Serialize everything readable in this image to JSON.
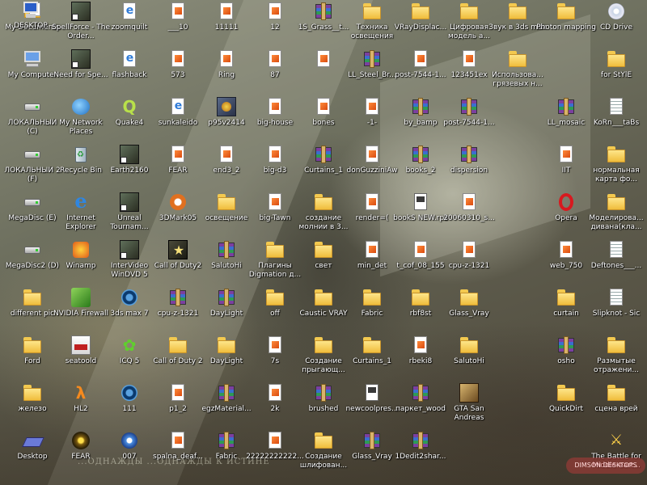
{
  "desktop": {
    "icons": [
      {
        "label": "My Documents",
        "type": "mydocs",
        "icon": "my-documents-icon"
      },
      {
        "label": "SpellForce - The Order...",
        "type": "shortcut",
        "icon": "spellforce-icon"
      },
      {
        "label": "zoomquilt",
        "type": "web",
        "icon": "html-file-icon"
      },
      {
        "label": "___10",
        "type": "file",
        "icon": "image-file-icon"
      },
      {
        "label": "11111",
        "type": "file",
        "icon": "image-file-icon"
      },
      {
        "label": "12",
        "type": "file",
        "icon": "image-file-icon"
      },
      {
        "label": "1S_Grass__t...",
        "type": "rar",
        "icon": "archive-icon"
      },
      {
        "label": "Техника освещения",
        "type": "folder",
        "icon": "folder-icon"
      },
      {
        "label": "VRayDisplac...",
        "type": "folder",
        "icon": "folder-icon"
      },
      {
        "label": "Цифровая модель а...",
        "type": "folder",
        "icon": "folder-icon"
      },
      {
        "label": "Звук в 3ds max",
        "type": "folder",
        "icon": "folder-icon"
      },
      {
        "label": "Photon mapping",
        "type": "folder",
        "icon": "folder-icon"
      },
      {
        "label": "CD Drive",
        "type": "cd",
        "icon": "cd-drive-icon"
      },
      {
        "label": "My Computer",
        "type": "mycomp",
        "icon": "my-computer-icon"
      },
      {
        "label": "Need for Spe...",
        "type": "shortcut",
        "icon": "need-for-speed-icon"
      },
      {
        "label": "flashback",
        "type": "web",
        "icon": "html-file-icon"
      },
      {
        "label": "573",
        "type": "file",
        "icon": "image-file-icon"
      },
      {
        "label": "Ring",
        "type": "file",
        "icon": "image-file-icon"
      },
      {
        "label": "87",
        "type": "file",
        "icon": "image-file-icon"
      },
      {
        "label": "",
        "type": "file",
        "icon": "image-file-icon"
      },
      {
        "label": "LL_Steel_Br...",
        "type": "rar",
        "icon": "archive-icon"
      },
      {
        "label": "post-7544-1...",
        "type": "file",
        "icon": "image-file-icon"
      },
      {
        "label": "123451ex",
        "type": "file",
        "icon": "image-file-icon"
      },
      {
        "label": "Использова... грязевых н...",
        "type": "folder",
        "icon": "folder-icon"
      },
      {
        "label": "for StYlE",
        "type": "folder",
        "icon": "folder-icon"
      },
      {
        "label": "ЛОКАЛЬНЫЙ (C)",
        "type": "drive",
        "icon": "hard-drive-icon"
      },
      {
        "label": "My Network Places",
        "type": "network",
        "icon": "network-places-icon"
      },
      {
        "label": "Quake4",
        "type": "quake",
        "icon": "quake4-icon"
      },
      {
        "label": "sunkaleido",
        "type": "web",
        "icon": "html-file-icon"
      },
      {
        "label": "p95v2414",
        "type": "app",
        "icon": "program-icon"
      },
      {
        "label": "big-house",
        "type": "file",
        "icon": "image-file-icon"
      },
      {
        "label": "bones",
        "type": "file",
        "icon": "image-file-icon"
      },
      {
        "label": "-1-",
        "type": "file",
        "icon": "image-file-icon"
      },
      {
        "label": "by_bamp",
        "type": "rar",
        "icon": "archive-icon"
      },
      {
        "label": "post-7544-1...",
        "type": "rar",
        "icon": "archive-icon"
      },
      {
        "label": "LL_mosaic",
        "type": "rar",
        "icon": "archive-icon"
      },
      {
        "label": "KoRn___taBs",
        "type": "txt",
        "icon": "text-file-icon"
      },
      {
        "label": "ЛОКАЛЬНЫЙ 2 (F)",
        "type": "drive",
        "icon": "hard-drive-icon"
      },
      {
        "label": "Recycle Bin",
        "type": "recycle",
        "icon": "recycle-bin-icon"
      },
      {
        "label": "Earth2160",
        "type": "shortcut",
        "icon": "earth2160-icon"
      },
      {
        "label": "FEAR",
        "type": "file",
        "icon": "image-file-icon"
      },
      {
        "label": "end3_2",
        "type": "file",
        "icon": "image-file-icon"
      },
      {
        "label": "big-d3",
        "type": "file",
        "icon": "image-file-icon"
      },
      {
        "label": "Curtains_1",
        "type": "rar",
        "icon": "archive-icon"
      },
      {
        "label": "donGuzziniAw",
        "type": "file",
        "icon": "image-file-icon"
      },
      {
        "label": "books_2",
        "type": "rar",
        "icon": "archive-icon"
      },
      {
        "label": "dispersion",
        "type": "rar",
        "icon": "archive-icon"
      },
      {
        "label": "IIT",
        "type": "file",
        "icon": "image-file-icon"
      },
      {
        "label": "нормальная карта фо...",
        "type": "folder",
        "icon": "folder-icon"
      },
      {
        "label": "MegaDisc (E)",
        "type": "drive",
        "icon": "hard-drive-icon"
      },
      {
        "label": "Internet Explorer",
        "type": "ie",
        "icon": "internet-explorer-icon"
      },
      {
        "label": "Unreal Tournam...",
        "type": "shortcut",
        "icon": "unreal-tournament-icon"
      },
      {
        "label": "3DMark05",
        "type": "mark3d",
        "icon": "3dmark-icon"
      },
      {
        "label": "освещение",
        "type": "folder",
        "icon": "folder-icon"
      },
      {
        "label": "big-Tawn",
        "type": "file",
        "icon": "image-file-icon"
      },
      {
        "label": "создание молнии в 3...",
        "type": "folder",
        "icon": "folder-icon"
      },
      {
        "label": "render=(",
        "type": "file",
        "icon": "image-file-icon"
      },
      {
        "label": "bookS NEW.rps",
        "type": "rps",
        "icon": "rps-file-icon"
      },
      {
        "label": "20060310_s...",
        "type": "file",
        "icon": "image-file-icon"
      },
      {
        "label": "Opera",
        "type": "opera",
        "icon": "opera-icon"
      },
      {
        "label": "Моделирова... дивана(кла...",
        "type": "folder",
        "icon": "folder-icon"
      },
      {
        "label": "MegaDisc2 (D)",
        "type": "drive",
        "icon": "hard-drive-icon"
      },
      {
        "label": "Winamp",
        "type": "winamp",
        "icon": "winamp-icon"
      },
      {
        "label": "InterVideo WinDVD 5",
        "type": "shortcut",
        "icon": "windvd-icon"
      },
      {
        "label": "Call of Duty2",
        "type": "cod",
        "icon": "call-of-duty-icon"
      },
      {
        "label": "SalutoHi",
        "type": "rar",
        "icon": "archive-icon"
      },
      {
        "label": "Плагины Digmation д...",
        "type": "folder",
        "icon": "folder-icon"
      },
      {
        "label": "свет",
        "type": "folder",
        "icon": "folder-icon"
      },
      {
        "label": "min_det",
        "type": "file",
        "icon": "image-file-icon"
      },
      {
        "label": "t_cof_08_155",
        "type": "file",
        "icon": "image-file-icon"
      },
      {
        "label": "cpu-z-1321",
        "type": "file",
        "icon": "image-file-icon"
      },
      {
        "label": "web_750",
        "type": "file",
        "icon": "image-file-icon"
      },
      {
        "label": "Deftones___...",
        "type": "txt",
        "icon": "text-file-icon"
      },
      {
        "label": "different pic",
        "type": "folder",
        "icon": "folder-icon"
      },
      {
        "label": "NVIDIA Firewall",
        "type": "nvidia",
        "icon": "nvidia-firewall-icon"
      },
      {
        "label": "3ds max 7",
        "type": "max",
        "icon": "3ds-max-icon"
      },
      {
        "label": "cpu-z-1321",
        "type": "rar",
        "icon": "archive-icon"
      },
      {
        "label": "DayLight",
        "type": "rar",
        "icon": "archive-icon"
      },
      {
        "label": "off",
        "type": "folder",
        "icon": "folder-icon"
      },
      {
        "label": "Caustic VRAY",
        "type": "folder",
        "icon": "folder-icon"
      },
      {
        "label": "Fabric",
        "type": "folder",
        "icon": "folder-icon"
      },
      {
        "label": "rbf8st",
        "type": "folder",
        "icon": "folder-icon"
      },
      {
        "label": "Glass_Vray",
        "type": "folder",
        "icon": "folder-icon"
      },
      {
        "label": "curtain",
        "type": "folder",
        "icon": "folder-icon"
      },
      {
        "label": "Slipknot - Sic",
        "type": "txt",
        "icon": "text-file-icon"
      },
      {
        "label": "Ford",
        "type": "folder",
        "icon": "folder-icon"
      },
      {
        "label": "seatoold",
        "type": "cassette",
        "icon": "cassette-icon"
      },
      {
        "label": "ICQ 5",
        "type": "icq",
        "icon": "icq-icon"
      },
      {
        "label": "Call of Duty 2",
        "type": "folder",
        "icon": "folder-icon"
      },
      {
        "label": "DayLight",
        "type": "folder",
        "icon": "folder-icon"
      },
      {
        "label": "7s",
        "type": "file",
        "icon": "image-file-icon"
      },
      {
        "label": "Создание прыгающ...",
        "type": "folder",
        "icon": "folder-icon"
      },
      {
        "label": "Curtains_1",
        "type": "folder",
        "icon": "folder-icon"
      },
      {
        "label": "rbeki8",
        "type": "file",
        "icon": "image-file-icon"
      },
      {
        "label": "SalutoHi",
        "type": "folder",
        "icon": "folder-icon"
      },
      {
        "label": "osho",
        "type": "rar",
        "icon": "archive-icon"
      },
      {
        "label": "Размытые отражени...",
        "type": "folder",
        "icon": "folder-icon"
      },
      {
        "label": "железо",
        "type": "folder",
        "icon": "folder-icon"
      },
      {
        "label": "HL2",
        "type": "hl2",
        "icon": "half-life-2-icon"
      },
      {
        "label": "111",
        "type": "max",
        "icon": "3ds-max-file-icon"
      },
      {
        "label": "p1_2",
        "type": "file",
        "icon": "image-file-icon"
      },
      {
        "label": "egzMaterial...",
        "type": "rar",
        "icon": "archive-icon"
      },
      {
        "label": "2k",
        "type": "file",
        "icon": "image-file-icon"
      },
      {
        "label": "brushed",
        "type": "rar",
        "icon": "archive-icon"
      },
      {
        "label": "newcoolpres...",
        "type": "rps",
        "icon": "rps-file-icon"
      },
      {
        "label": "паркет_wood",
        "type": "rar",
        "icon": "archive-icon"
      },
      {
        "label": "GTA San Andreas",
        "type": "gta",
        "icon": "gta-san-andreas-icon"
      },
      {
        "label": "QuickDirt",
        "type": "folder",
        "icon": "folder-icon"
      },
      {
        "label": "сцена врей",
        "type": "folder",
        "icon": "folder-icon"
      },
      {
        "label": "Desktop",
        "type": "desk",
        "icon": "desktop-folder-icon"
      },
      {
        "label": "FEAR",
        "type": "fear",
        "icon": "fear-icon"
      },
      {
        "label": "007",
        "type": "media",
        "icon": "media-file-icon"
      },
      {
        "label": "spalna_deaf...",
        "type": "file",
        "icon": "image-file-icon"
      },
      {
        "label": "Fabric",
        "type": "rar",
        "icon": "archive-icon"
      },
      {
        "label": "22222222222...",
        "type": "file",
        "icon": "image-file-icon"
      },
      {
        "label": "Создание шлифован...",
        "type": "folder",
        "icon": "folder-icon"
      },
      {
        "label": "Glass_Vray",
        "type": "rar",
        "icon": "archive-icon"
      },
      {
        "label": "1Dedit2shar...",
        "type": "rar",
        "icon": "archive-icon"
      },
      {
        "label": "The Battle for Middle-eart...",
        "type": "lotr",
        "icon": "battle-middle-earth-icon"
      },
      {
        "label": "DESKTOP",
        "type": "deskpc",
        "icon": "desktop-computer-icon"
      }
    ],
    "watermark": "DIMSON DESKTOPS",
    "slogan": "...ОДНАЖДЫ ...ОДНАЖДЫ К ИСТИНЕ"
  }
}
